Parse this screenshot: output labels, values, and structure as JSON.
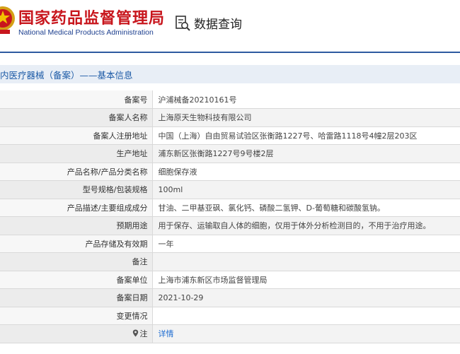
{
  "header": {
    "logo_cn": "国家药品监督管理局",
    "logo_en": "National Medical Products Administration",
    "query_label": "数据查询"
  },
  "section_title": "内医疗器械（备案）——基本信息",
  "rows": [
    {
      "label": "备案号",
      "value": "沪浦械备20210161号"
    },
    {
      "label": "备案人名称",
      "value": "上海原天生物科技有限公司"
    },
    {
      "label": "备案人注册地址",
      "value": "中国（上海）自由贸易试验区张衡路1227号、哈雷路1118号4幢2层203区"
    },
    {
      "label": "生产地址",
      "value": "浦东新区张衡路1227号9号楼2层"
    },
    {
      "label": "产品名称/产品分类名称",
      "value": "细胞保存液"
    },
    {
      "label": "型号规格/包装规格",
      "value": "100ml"
    },
    {
      "label": "产品描述/主要组成成分",
      "value": "甘油、二甲基亚砜、氯化钙、磷酸二氢钾、D-葡萄糖和碳酸氢钠。"
    },
    {
      "label": "预期用途",
      "value": "用于保存、运输取自人体的细胞，仅用于体外分析检测目的，不用于治疗用途。"
    },
    {
      "label": "产品存储及有效期",
      "value": "一年"
    },
    {
      "label": "备注",
      "value": ""
    },
    {
      "label": "备案单位",
      "value": "上海市浦东新区市场监督管理局"
    },
    {
      "label": "备案日期",
      "value": "2021-10-29"
    },
    {
      "label": "变更情况",
      "value": ""
    },
    {
      "label": "注",
      "value": "详情"
    }
  ],
  "colors": {
    "brand_red": "#c8161d",
    "brand_blue": "#1d3f8f",
    "link": "#1c6bd1"
  },
  "icons": [
    "emblem-icon",
    "search-document-icon",
    "location-pin-icon"
  ]
}
